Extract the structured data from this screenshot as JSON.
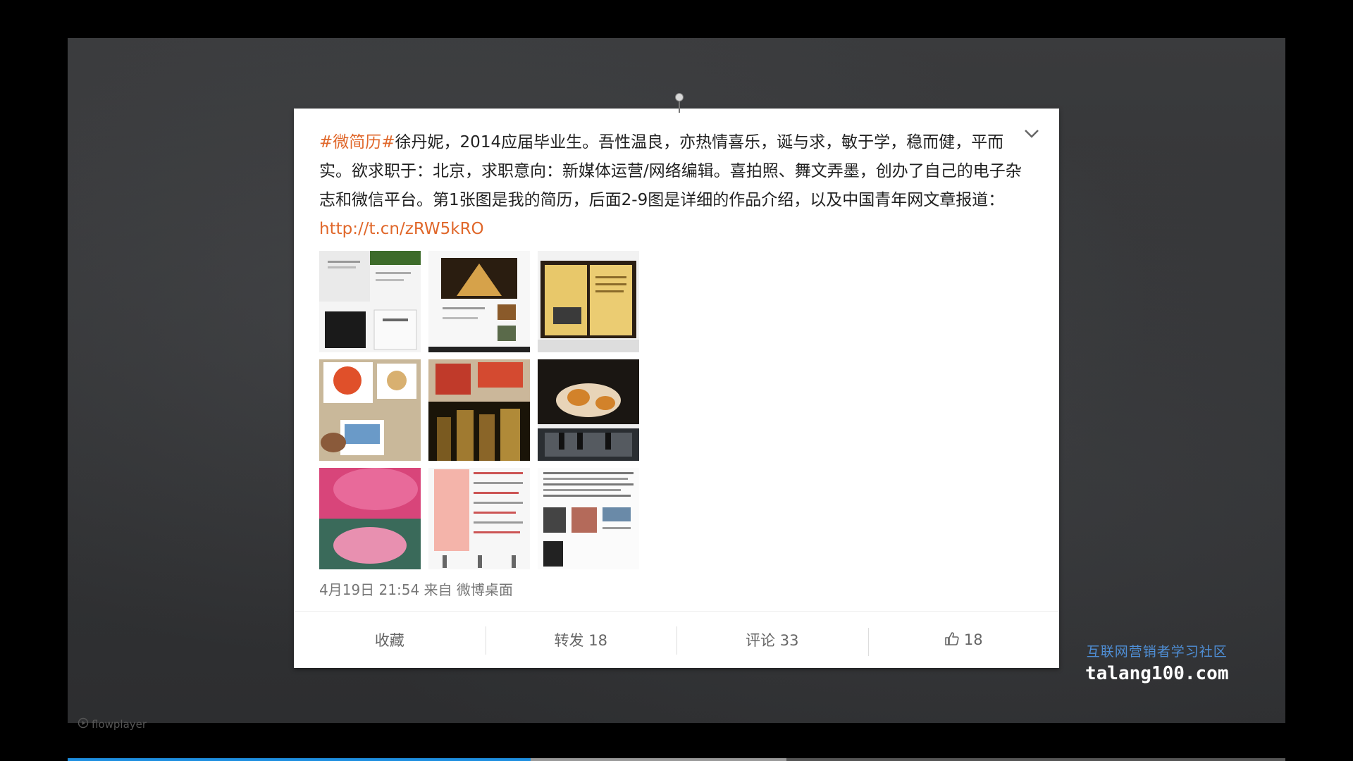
{
  "post": {
    "hashtag": "#微简历#",
    "body": "徐丹妮，2014应届毕业生。吾性温良，亦热情喜乐，诞与求，敏于学，稳而健，平而实。欲求职于：北京，求职意向：新媒体运营/网络编辑。喜拍照、舞文弄墨，创办了自己的电子杂志和微信平台。第1张图是我的简历，后面2-9图是详细的作品介绍，以及中国青年网文章报道：",
    "link": "http://t.cn/zRW5kRO",
    "meta": "4月19日 21:54 来自 微博桌面"
  },
  "actions": {
    "favorite": "收藏",
    "repost": "转发 18",
    "comment": "评论 33",
    "like": "18"
  },
  "watermark": {
    "cn": "互联网营销者学习社区",
    "en": "talang100.com"
  },
  "player": {
    "brand": "flowplayer",
    "progress": 0.38,
    "buffered": 0.59
  },
  "colors": {
    "accent": "#e0672a",
    "watermark_blue": "#4f8fd6",
    "progress_blue": "#1e8fe0"
  }
}
